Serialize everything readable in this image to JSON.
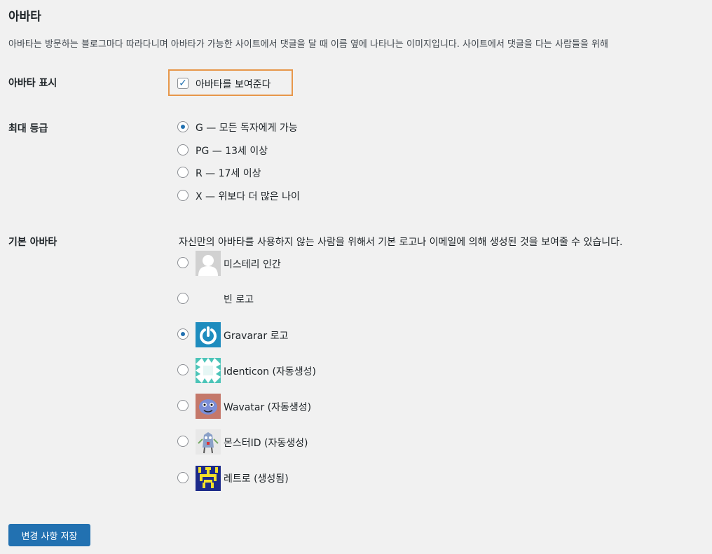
{
  "section": {
    "title": "아바타",
    "description": "아바타는 방문하는 블로그마다 따라다니며 아바타가 가능한 사이트에서 댓글을 달 때 이름 옆에 나타나는 이미지입니다. 사이트에서 댓글을 다는 사람들을 위해"
  },
  "show_avatars": {
    "label": "아바타 표시",
    "checkbox_label": "아바타를 보여준다",
    "checked": true,
    "highlight_color": "#e7974a"
  },
  "max_rating": {
    "label": "최대 등급",
    "options": [
      {
        "label": "G — 모든 독자에게 가능",
        "checked": true
      },
      {
        "label": "PG — 13세 이상",
        "checked": false
      },
      {
        "label": "R — 17세 이상",
        "checked": false
      },
      {
        "label": "X — 위보다 더 많은 나이",
        "checked": false
      }
    ]
  },
  "default_avatar": {
    "label": "기본 아바타",
    "description": "자신만의 아바타를 사용하지 않는 사람을 위해서 기본 로고나 이메일에 의해 생성된 것을 보여줄 수 있습니다.",
    "options": [
      {
        "label": "미스테리 인간",
        "icon": "mystery-person-icon",
        "checked": false
      },
      {
        "label": "빈 로고",
        "icon": "blank-icon",
        "checked": false
      },
      {
        "label": "Gravarar 로고",
        "icon": "gravatar-logo-icon",
        "checked": true
      },
      {
        "label": "Identicon (자동생성)",
        "icon": "identicon-icon",
        "checked": false
      },
      {
        "label": "Wavatar (자동생성)",
        "icon": "wavatar-icon",
        "checked": false
      },
      {
        "label": "몬스터ID (자동생성)",
        "icon": "monsterid-icon",
        "checked": false
      },
      {
        "label": "레트로 (생성됨)",
        "icon": "retro-icon",
        "checked": false
      }
    ]
  },
  "save_button": {
    "label": "변경 사항 저장"
  },
  "colors": {
    "accent": "#2271b1",
    "background": "#f1f1f1"
  }
}
